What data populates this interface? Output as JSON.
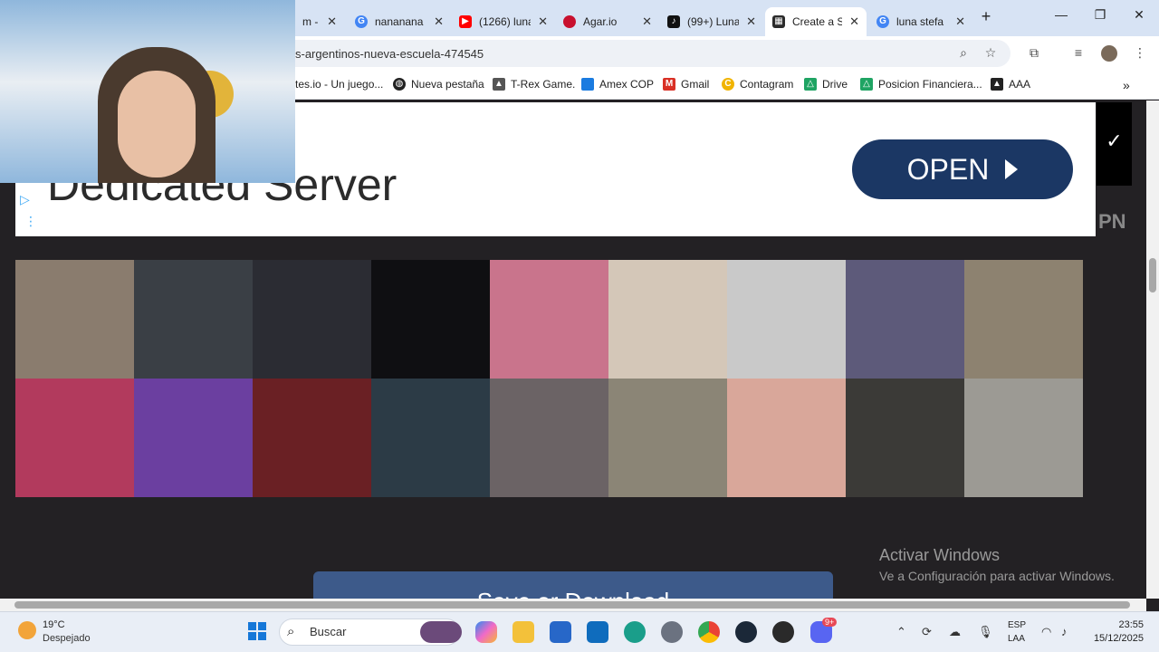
{
  "tabs": [
    {
      "title": "m - ",
      "favicon_color": "#c0c0c0",
      "icon": "generic-tab-icon"
    },
    {
      "title": "nananana",
      "favicon_color": "#4285f4",
      "icon": "google-icon"
    },
    {
      "title": "(1266) luna",
      "favicon_color": "#ff0000",
      "icon": "youtube-icon"
    },
    {
      "title": "Agar.io",
      "favicon_color": "#c8102e",
      "icon": "agario-icon"
    },
    {
      "title": "(99+) Luna",
      "favicon_color": "#111111",
      "icon": "tiktok-icon"
    },
    {
      "title": "Create a S",
      "favicon_color": "#2b2b2b",
      "icon": "tierlist-icon"
    },
    {
      "title": "luna stefa",
      "favicon_color": "#4285f4",
      "icon": "google-icon"
    }
  ],
  "url": "s-argentinos-nueva-escuela-474545",
  "bookmarks": [
    {
      "label": "tes.io - Un juego...",
      "color": "#ffffff",
      "icon": "generic-bookmark-icon"
    },
    {
      "label": "Nueva pestaña",
      "color": "#222222",
      "icon": "globe-icon"
    },
    {
      "label": "T-Rex Game.",
      "color": "#555555",
      "icon": "dino-icon"
    },
    {
      "label": "Amex COP",
      "color": "#1a7be0",
      "icon": "amex-icon"
    },
    {
      "label": "Gmail",
      "color": "#d93025",
      "icon": "gmail-icon"
    },
    {
      "label": "Contagram",
      "color": "#f1b400",
      "icon": "contagram-icon"
    },
    {
      "label": "Drive",
      "color": "#1fa463",
      "icon": "drive-icon"
    },
    {
      "label": "Posicion Financiera...",
      "color": "#1fa463",
      "icon": "drive-icon"
    },
    {
      "label": "AAA",
      "color": "#222222",
      "icon": "triangle-icon"
    }
  ],
  "ad": {
    "title": "Dedicated Server",
    "button": "OPEN",
    "side_label": "PN"
  },
  "grid_tiles": [
    "#8a7c6e",
    "#3a3f45",
    "#2b2c33",
    "#0f0f12",
    "#c9748c",
    "#d4c7b8",
    "#c9c9c9",
    "#5d5a7a",
    "#8d8270",
    "#b23a5d",
    "#6b3fa0",
    "#6a2024",
    "#2c3b46",
    "#6b6365",
    "#8b8576",
    "#d9a79a",
    "#3b3a37",
    "#9c9a94"
  ],
  "save_button": "Save or Download",
  "activation": {
    "title": "Activar Windows",
    "subtitle": "Ve a Configuración para activar Windows."
  },
  "taskbar": {
    "temperature": "19°C",
    "weather": "Despejado",
    "search_placeholder": "Buscar",
    "lang_top": "ESP",
    "lang_bottom": "LAA",
    "time": "23:55",
    "date": "15/12/2025",
    "discord_badge": "9+"
  }
}
